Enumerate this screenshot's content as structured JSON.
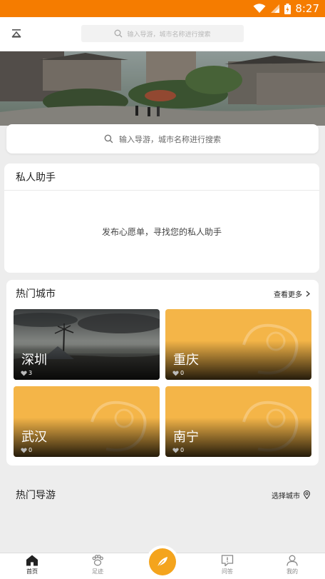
{
  "status_bar": {
    "time": "8:27",
    "icons": [
      "wifi-icon",
      "signal-icon",
      "battery-icon"
    ]
  },
  "top_bar": {
    "search_placeholder": "输入导游，城市名称进行搜索"
  },
  "banner": {
    "image": "banner-photo"
  },
  "search_card": {
    "placeholder": "输入导游，城市名称进行搜索"
  },
  "assistant": {
    "title": "私人助手",
    "message": "发布心愿单，寻找您的私人助手"
  },
  "hot_cities": {
    "title": "热门城市",
    "more_label": "查看更多",
    "items": [
      {
        "name": "深圳",
        "likes": "3"
      },
      {
        "name": "重庆",
        "likes": "0"
      },
      {
        "name": "武汉",
        "likes": "0"
      },
      {
        "name": "南宁",
        "likes": "0"
      }
    ]
  },
  "hot_guides": {
    "title": "热门导游",
    "select_city_label": "选择城市"
  },
  "tab_bar": {
    "tabs": [
      {
        "label": "首页",
        "icon": "home-icon",
        "active": true
      },
      {
        "label": "足迹",
        "icon": "paw-icon",
        "active": false
      },
      {
        "label": "问答",
        "icon": "qa-icon",
        "active": false
      },
      {
        "label": "我的",
        "icon": "user-icon",
        "active": false
      }
    ],
    "center_icon": "feather-icon"
  },
  "colors": {
    "status_bar": "#f57c00",
    "accent": "#f4a41d",
    "card_placeholder": "#f4b548"
  }
}
